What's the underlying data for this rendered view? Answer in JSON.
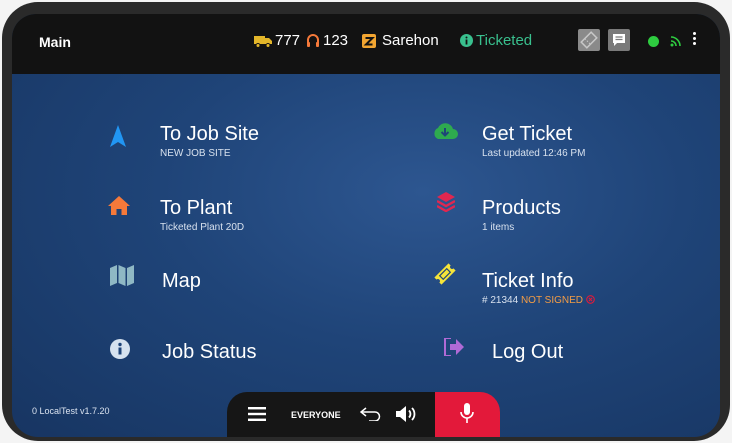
{
  "topbar": {
    "title": "Main",
    "truck_number": "777",
    "driver_number": "123",
    "driver_name": "Sarehon",
    "status": "Ticketed"
  },
  "menu": {
    "to_job_site": {
      "title": "To Job Site",
      "subtitle": "NEW JOB SITE"
    },
    "get_ticket": {
      "title": "Get Ticket",
      "subtitle": "Last updated 12:46 PM"
    },
    "to_plant": {
      "title": "To Plant",
      "subtitle": "Ticketed Plant 20D"
    },
    "products": {
      "title": "Products",
      "subtitle": "1 items"
    },
    "map": {
      "title": "Map"
    },
    "ticket_info": {
      "title": "Ticket Info",
      "ticket_number": "# 21344",
      "sign_status": "NOT SIGNED"
    },
    "job_status": {
      "title": "Job Status"
    },
    "log_out": {
      "title": "Log Out"
    }
  },
  "version": "0 LocalTest v1.7.20",
  "bottombar": {
    "channel": "EVERYONE"
  },
  "colors": {
    "ticketed": "#39c08e",
    "not_signed": "#f39c45",
    "mic": "#e3193a",
    "navigation": "#2196f3",
    "home": "#f5793a",
    "download": "#2eaa4f",
    "products": "#e02750",
    "map": "#8fb8c4",
    "ticket": "#f5e43a",
    "logout": "#b06ad6",
    "online": "#2ecc40"
  },
  "icons": [
    "truck-icon",
    "headset-icon",
    "driver-badge-icon",
    "info-icon",
    "ticket-icon",
    "message-icon",
    "wifi-icon",
    "navigation-icon",
    "cloud-download-icon",
    "home-icon",
    "layers-icon",
    "map-icon",
    "ticket-icon",
    "info-circle-icon",
    "logout-icon",
    "menu-icon",
    "undo-icon",
    "volume-icon",
    "mic-icon"
  ]
}
